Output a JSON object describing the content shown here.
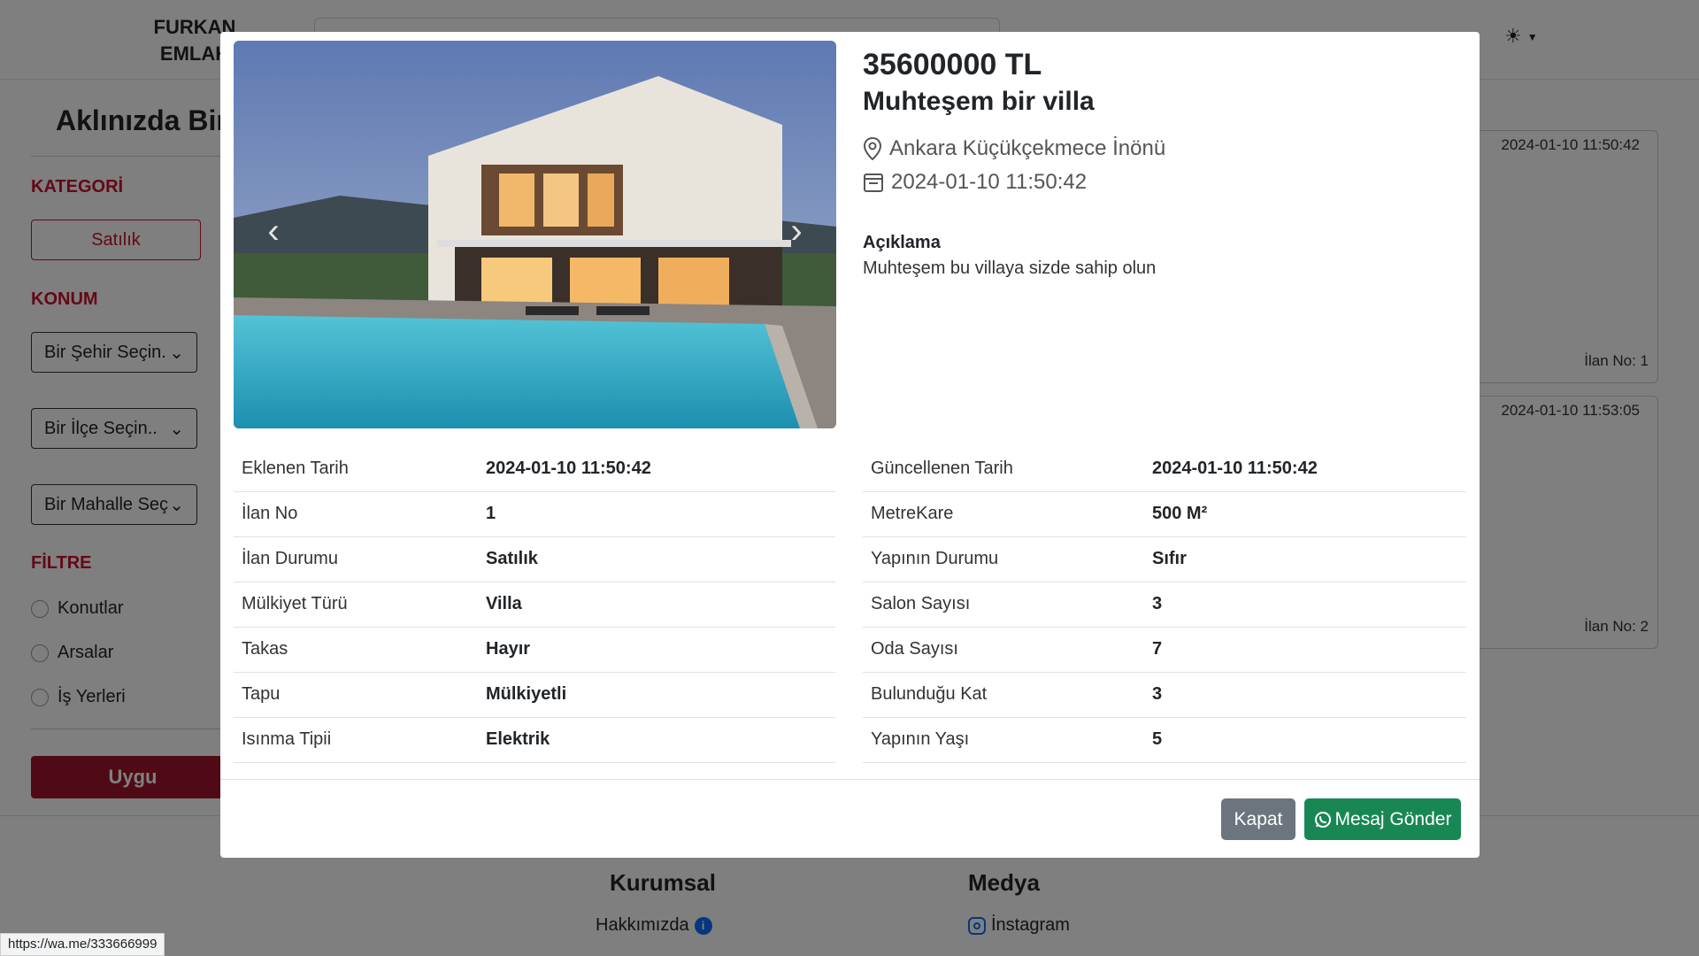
{
  "background": {
    "brand": "FURKAN EMLAK",
    "hero_title": "Aklınızda Birş",
    "sidebar": {
      "category_heading": "KATEGORİ",
      "category_button": "Satılık",
      "location_heading": "KONUM",
      "city_select": "Bir Şehir Seçin.",
      "district_select": "Bir İlçe Seçin..",
      "neighborhood_select": "Bir Mahalle Seç",
      "filter_heading": "FİLTRE",
      "filters": [
        "Konutlar",
        "Arsalar",
        "İş Yerleri"
      ],
      "apply_button": "Uygu"
    },
    "listings": [
      {
        "date": "2024-01-10 11:50:42",
        "number": "İlan No: 1"
      },
      {
        "date": "2024-01-10 11:53:05",
        "number": "İlan No: 2"
      }
    ],
    "footer": {
      "corporate_title": "Kurumsal",
      "about_link": "Hakkımızda",
      "media_title": "Medya",
      "instagram_link": "İnstagram"
    }
  },
  "status_url": "https://wa.me/333666999",
  "modal": {
    "price": "35600000 TL",
    "title": "Muhteşem bir villa",
    "location": "Ankara Küçükçekmece İnönü",
    "date": "2024-01-10 11:50:42",
    "description_heading": "Açıklama",
    "description": "Muhteşem bu villaya sizde sahip olun",
    "left_specs": [
      {
        "label": "Eklenen Tarih",
        "value": "2024-01-10 11:50:42"
      },
      {
        "label": "İlan No",
        "value": "1"
      },
      {
        "label": "İlan Durumu",
        "value": "Satılık"
      },
      {
        "label": "Mülkiyet Türü",
        "value": "Villa"
      },
      {
        "label": "Takas",
        "value": "Hayır"
      },
      {
        "label": "Tapu",
        "value": "Mülkiyetli"
      },
      {
        "label": "Isınma Tipii",
        "value": "Elektrik"
      }
    ],
    "right_specs": [
      {
        "label": "Güncellenen Tarih",
        "value": "2024-01-10 11:50:42"
      },
      {
        "label": "MetreKare",
        "value": "500 M²"
      },
      {
        "label": "Yapının Durumu",
        "value": "Sıfır"
      },
      {
        "label": "Salon Sayısı",
        "value": "3"
      },
      {
        "label": "Oda Sayısı",
        "value": "7"
      },
      {
        "label": "Bulunduğu Kat",
        "value": "3"
      },
      {
        "label": "Yapının Yaşı",
        "value": "5"
      }
    ],
    "close_button": "Kapat",
    "whatsapp_button": "Mesaj Gönder",
    "colors": {
      "close": "#6c757d",
      "whatsapp": "#198754",
      "accent": "#c8102e"
    }
  }
}
